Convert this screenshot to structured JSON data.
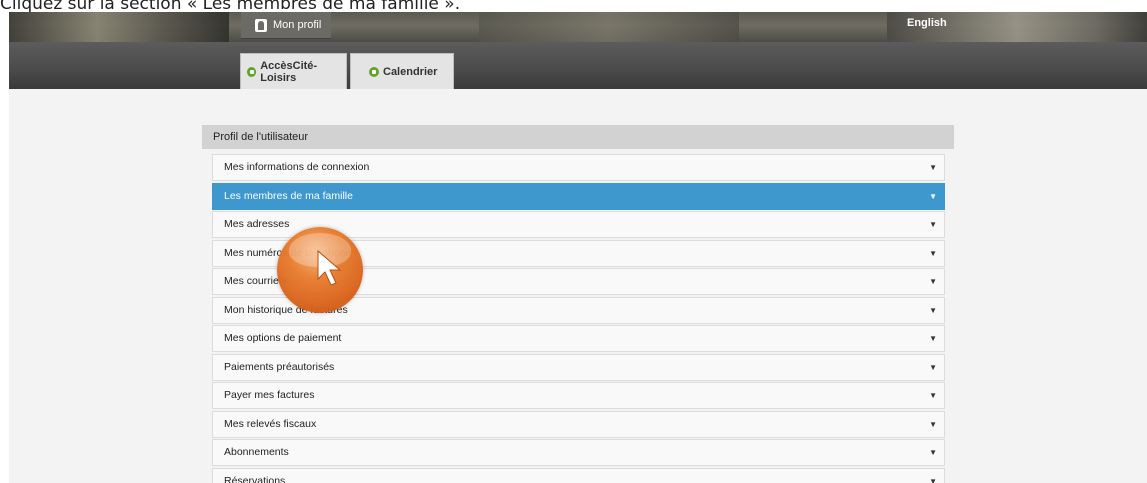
{
  "caption": "Cliquez sur la section « Les membres de ma famille ».",
  "header": {
    "profile_label": "Mon profil",
    "language_link": "English"
  },
  "nav": {
    "tabs": [
      {
        "label": "AccèsCité-Loisirs"
      },
      {
        "label": "Calendrier"
      }
    ]
  },
  "panel": {
    "title": "Profil de l'utilisateur",
    "sections": [
      {
        "label": "Mes informations de connexion"
      },
      {
        "label": "Les membres de ma famille"
      },
      {
        "label": "Mes adresses"
      },
      {
        "label": "Mes numéros de téléphone"
      },
      {
        "label": "Mes courriels"
      },
      {
        "label": "Mon historique de factures"
      },
      {
        "label": "Mes options de paiement"
      },
      {
        "label": "Paiements préautorisés"
      },
      {
        "label": "Payer mes factures"
      },
      {
        "label": "Mes relevés fiscaux"
      },
      {
        "label": "Abonnements"
      },
      {
        "label": "Réservations"
      }
    ],
    "active_index": 1
  },
  "colors": {
    "active_row": "#3e97cd",
    "tab_icon": "#63a52a",
    "cursor_highlight": "#e87b2c"
  },
  "icons": {
    "caret": "▼"
  }
}
